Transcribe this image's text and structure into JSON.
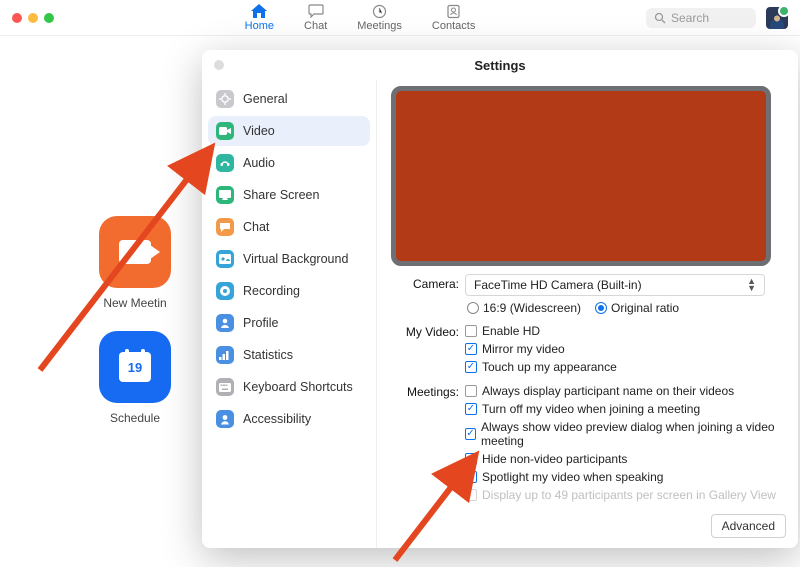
{
  "topbar": {
    "tabs": [
      {
        "label": "Home"
      },
      {
        "label": "Chat"
      },
      {
        "label": "Meetings"
      },
      {
        "label": "Contacts"
      }
    ],
    "search_placeholder": "Search"
  },
  "home_tiles": {
    "new_meeting": "New Meetin",
    "schedule": "Schedule",
    "calendar_day": "19"
  },
  "settings": {
    "title": "Settings",
    "sidebar": [
      {
        "label": "General",
        "color": "#c9c9cd"
      },
      {
        "label": "Video",
        "color": "#2fb67b"
      },
      {
        "label": "Audio",
        "color": "#2fb6a1"
      },
      {
        "label": "Share Screen",
        "color": "#2fb67b"
      },
      {
        "label": "Chat",
        "color": "#f2994a"
      },
      {
        "label": "Virtual Background",
        "color": "#36a3d9"
      },
      {
        "label": "Recording",
        "color": "#36a3d9"
      },
      {
        "label": "Profile",
        "color": "#4a90e2"
      },
      {
        "label": "Statistics",
        "color": "#4a90e2"
      },
      {
        "label": "Keyboard Shortcuts",
        "color": "#b0b0b5"
      },
      {
        "label": "Accessibility",
        "color": "#4a90e2"
      }
    ],
    "camera_label": "Camera:",
    "camera_value": "FaceTime HD Camera (Built-in)",
    "ratio": {
      "widescreen": "16:9 (Widescreen)",
      "original": "Original ratio"
    },
    "myvideo_label": "My Video:",
    "myvideo": [
      {
        "label": "Enable HD",
        "checked": false
      },
      {
        "label": "Mirror my video",
        "checked": true
      },
      {
        "label": "Touch up my appearance",
        "checked": true
      }
    ],
    "meetings_label": "Meetings:",
    "meetings": [
      {
        "label": "Always display participant name on their videos",
        "checked": false
      },
      {
        "label": "Turn off my video when joining a meeting",
        "checked": true
      },
      {
        "label": "Always show video preview dialog when joining a video meeting",
        "checked": true
      },
      {
        "label": "Hide non-video participants",
        "checked": true
      },
      {
        "label": "Spotlight my video when speaking",
        "checked": true
      },
      {
        "label": "Display up to 49 participants per screen in Gallery View",
        "checked": false,
        "disabled": true
      }
    ],
    "advanced": "Advanced"
  }
}
